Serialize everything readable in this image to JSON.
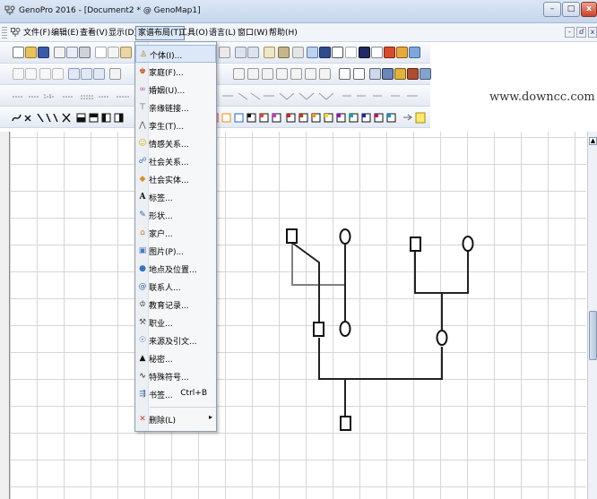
{
  "window": {
    "title": "GenoPro 2016 - [Document2 * @ GenoMap1]",
    "controls": {
      "minimize": "–",
      "maximize": "□",
      "close": "x"
    },
    "mdi_controls": {
      "minimize": "-",
      "restore": "ⅆ",
      "close": "x"
    }
  },
  "menubar": {
    "items": [
      {
        "label": "文件(F)"
      },
      {
        "label": "编辑(E)"
      },
      {
        "label": "查看(V)"
      },
      {
        "label": "显示(D)"
      },
      {
        "label": "家谱布局(T)",
        "active": true
      },
      {
        "label": "工具(O)"
      },
      {
        "label": "语言(L)"
      },
      {
        "label": "窗口(W)"
      },
      {
        "label": "帮助(H)"
      }
    ]
  },
  "watermark": "www.downcc.com",
  "layout_menu": {
    "items": [
      {
        "label": "个体(I)...",
        "icon": "person-icon",
        "highlight": true
      },
      {
        "label": "家庭(F)...",
        "icon": "family-icon"
      },
      {
        "label": "婚姻(U)...",
        "icon": "marriage-icon"
      },
      {
        "label": "亲缘链接...",
        "icon": "link-icon"
      },
      {
        "label": "孪生(T)...",
        "icon": "twins-icon"
      },
      {
        "label": "情感关系...",
        "icon": "emotion-icon"
      },
      {
        "label": "社会关系...",
        "icon": "social-relation-icon"
      },
      {
        "label": "社会实体...",
        "icon": "social-entity-icon"
      },
      {
        "label": "标签...",
        "icon": "label-icon"
      },
      {
        "label": "形状...",
        "icon": "shape-icon"
      },
      {
        "label": "家户...",
        "icon": "household-icon"
      },
      {
        "label": "图片(P)...",
        "icon": "picture-icon"
      },
      {
        "label": "地点及位置...",
        "icon": "globe-icon"
      },
      {
        "label": "联系人...",
        "icon": "contact-icon"
      },
      {
        "label": "教育记录...",
        "icon": "education-icon"
      },
      {
        "label": "职业...",
        "icon": "occupation-icon"
      },
      {
        "label": "来源及引文...",
        "icon": "source-icon"
      },
      {
        "label": "秘密...",
        "icon": "secret-icon"
      },
      {
        "label": "特殊符号...",
        "icon": "symbol-icon"
      },
      {
        "label": "书签...",
        "icon": "bookmark-icon",
        "shortcut": "Ctrl+B"
      },
      {
        "label": "删除(L)",
        "icon": "delete-icon",
        "submenu": true
      }
    ]
  },
  "colors": {
    "title_gradient_top": "#dbe7f5",
    "menu_highlight": "#dce8f8",
    "grid_line": "#d6d6d6",
    "tree_line": "#808080"
  }
}
